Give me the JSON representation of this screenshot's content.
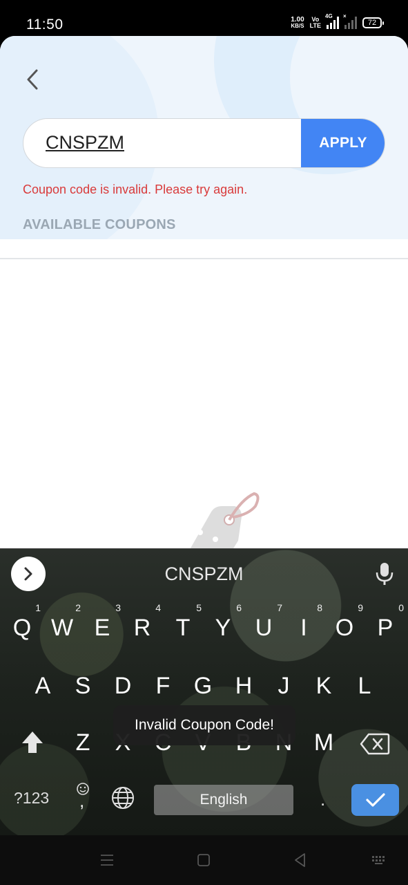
{
  "status_bar": {
    "time": "11:50",
    "net_speed_value": "1.00",
    "net_speed_unit": "KB/S",
    "volte_top": "Vo",
    "volte_bottom": "LTE",
    "network_type": "4G",
    "no_signal_mark": "×",
    "battery": "72"
  },
  "coupon": {
    "code": "CNSPZM",
    "apply_label": "APPLY",
    "error": "Coupon code is invalid. Please try again.",
    "section_title": "AVAILABLE COUPONS"
  },
  "keyboard": {
    "suggestion": "CNSPZM",
    "row1": [
      {
        "k": "Q",
        "n": "1"
      },
      {
        "k": "W",
        "n": "2"
      },
      {
        "k": "E",
        "n": "3"
      },
      {
        "k": "R",
        "n": "4"
      },
      {
        "k": "T",
        "n": "5"
      },
      {
        "k": "Y",
        "n": "6"
      },
      {
        "k": "U",
        "n": "7"
      },
      {
        "k": "I",
        "n": "8"
      },
      {
        "k": "O",
        "n": "9"
      },
      {
        "k": "P",
        "n": "0"
      }
    ],
    "row2": [
      "A",
      "S",
      "D",
      "F",
      "G",
      "H",
      "J",
      "K",
      "L"
    ],
    "row3": [
      "Z",
      "X",
      "C",
      "V",
      "B",
      "N",
      "M"
    ],
    "symbols_label": "?123",
    "comma_label": ",",
    "space_label": "English",
    "period_label": "."
  },
  "toast": "Invalid Coupon Code!",
  "colors": {
    "accent": "#4285f4",
    "error": "#d93a3a",
    "section_title": "#9aa7b3",
    "enter_key": "#4a90e2"
  },
  "icons": {
    "back": "chevron-left-icon",
    "expand": "chevron-right-icon",
    "mic": "microphone-icon",
    "shift": "shift-arrow-icon",
    "backspace": "backspace-icon",
    "emoji": "emoji-icon",
    "globe": "globe-icon",
    "enter": "checkmark-icon",
    "nav_menu": "menu-icon",
    "nav_home": "home-square-icon",
    "nav_back": "back-triangle-icon",
    "nav_keyboard": "keyboard-icon"
  }
}
